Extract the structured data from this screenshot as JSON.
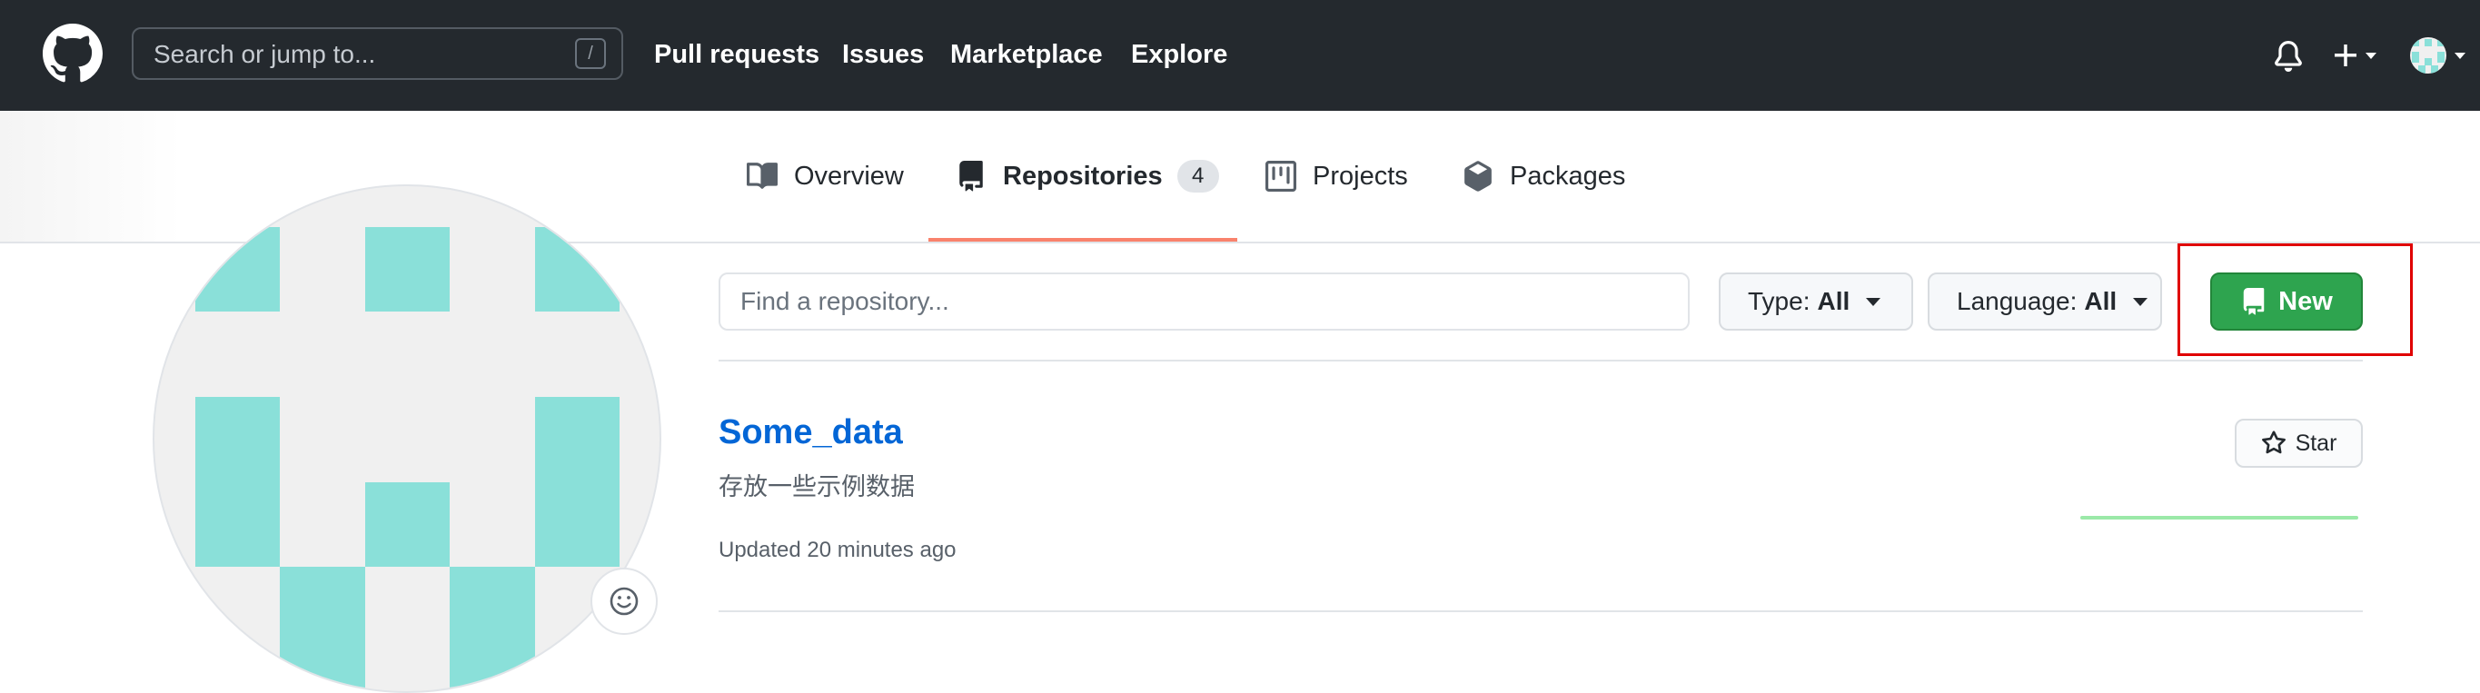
{
  "header": {
    "search_placeholder": "Search or jump to...",
    "search_shortcut": "/",
    "nav": [
      "Pull requests",
      "Issues",
      "Marketplace",
      "Explore"
    ]
  },
  "tabs": [
    {
      "label": "Overview",
      "icon": "book-icon",
      "selected": false
    },
    {
      "label": "Repositories",
      "icon": "repo-icon",
      "selected": true,
      "count": "4"
    },
    {
      "label": "Projects",
      "icon": "project-icon",
      "selected": false
    },
    {
      "label": "Packages",
      "icon": "package-icon",
      "selected": false
    }
  ],
  "filters": {
    "find_placeholder": "Find a repository...",
    "type_label": "Type:",
    "type_value": "All",
    "language_label": "Language:",
    "language_value": "All",
    "new_label": "New"
  },
  "repo": {
    "name": "Some_data",
    "description": "存放一些示例数据",
    "updated": "Updated 20 minutes ago",
    "star_label": "Star"
  },
  "colors": {
    "header_bg": "#24292e",
    "link_blue": "#0366d6",
    "new_green": "#2ea44f",
    "tab_underline": "#f9826c",
    "avatar_teal": "#8ae0d9",
    "highlight_red": "#e00000"
  }
}
